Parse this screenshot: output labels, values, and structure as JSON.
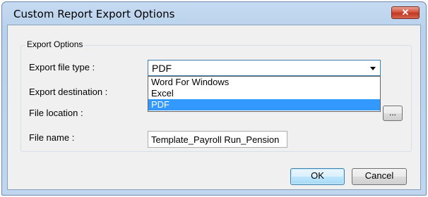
{
  "window": {
    "title": "Custom Report Export Options",
    "close_icon": "✕"
  },
  "group": {
    "label": "Export Options"
  },
  "fields": {
    "file_type_label": "Export file type :",
    "destination_label": "Export destination :",
    "location_label": "File location :",
    "name_label": "File name :"
  },
  "file_type": {
    "value": "PDF",
    "options": [
      "Word For Windows",
      "Excel",
      "PDF"
    ],
    "selected_index": 2
  },
  "file_name": {
    "value": "Template_Payroll Run_Pension"
  },
  "browse_button": {
    "label": "..."
  },
  "buttons": {
    "ok": "OK",
    "cancel": "Cancel"
  },
  "colors": {
    "selection": "#3399ff",
    "close_button": "#c2361f",
    "title_bar": "#b9d1ec"
  }
}
